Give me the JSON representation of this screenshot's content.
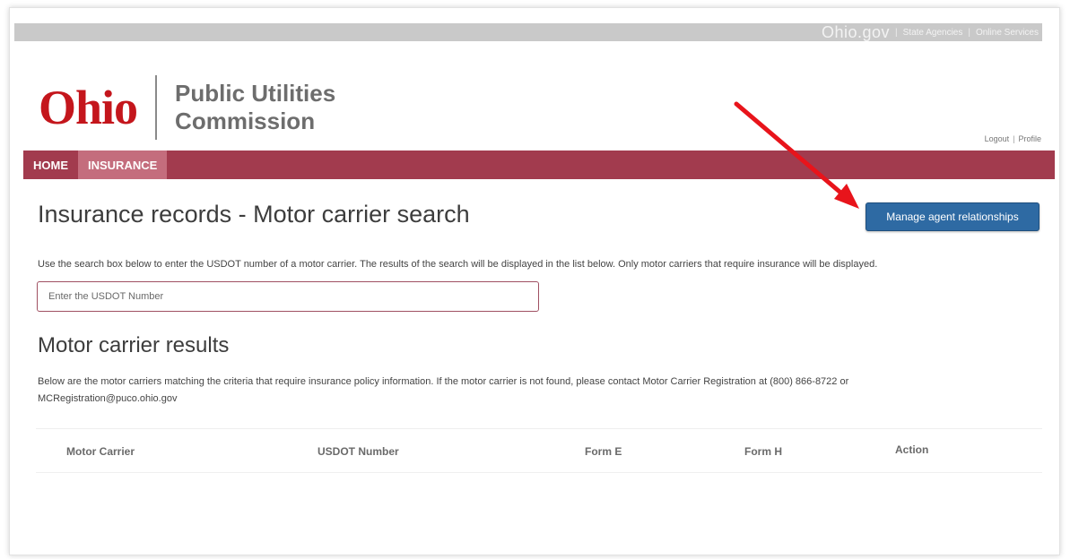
{
  "gov_bar": {
    "logo": "Ohio.gov",
    "links": [
      "State Agencies",
      "Online Services"
    ]
  },
  "logo": {
    "ohio": "Ohio",
    "line1": "Public Utilities",
    "line2": "Commission"
  },
  "user_links": {
    "logout": "Logout",
    "profile": "Profile"
  },
  "nav": {
    "items": [
      {
        "label": "HOME",
        "active": false
      },
      {
        "label": "INSURANCE",
        "active": true
      }
    ]
  },
  "page": {
    "title": "Insurance records - Motor carrier search",
    "manage_button": "Manage agent relationships",
    "intro": "Use the search box below to enter the USDOT number of a motor carrier. The results of the search will be displayed in the list below. Only motor carriers that require insurance will be displayed.",
    "search_placeholder": "Enter the USDOT Number",
    "search_value": ""
  },
  "results": {
    "title": "Motor carrier results",
    "description_line1": "Below are the motor carriers matching the criteria that require insurance policy information. If the motor carrier is not found, please contact Motor Carrier Registration at (800) 866-8722 or",
    "description_line2": "MCRegistration@puco.ohio.gov",
    "columns": [
      "Motor Carrier",
      "USDOT Number",
      "Form E",
      "Form H",
      "Action"
    ]
  },
  "colors": {
    "nav_bg": "#a23b4e",
    "nav_active": "#c46d7d",
    "button_bg": "#2e6aa3",
    "ohio_red": "#c4161c",
    "annotation_arrow": "#e8141b"
  },
  "icons": {
    "annotation": "red-arrow-icon"
  }
}
